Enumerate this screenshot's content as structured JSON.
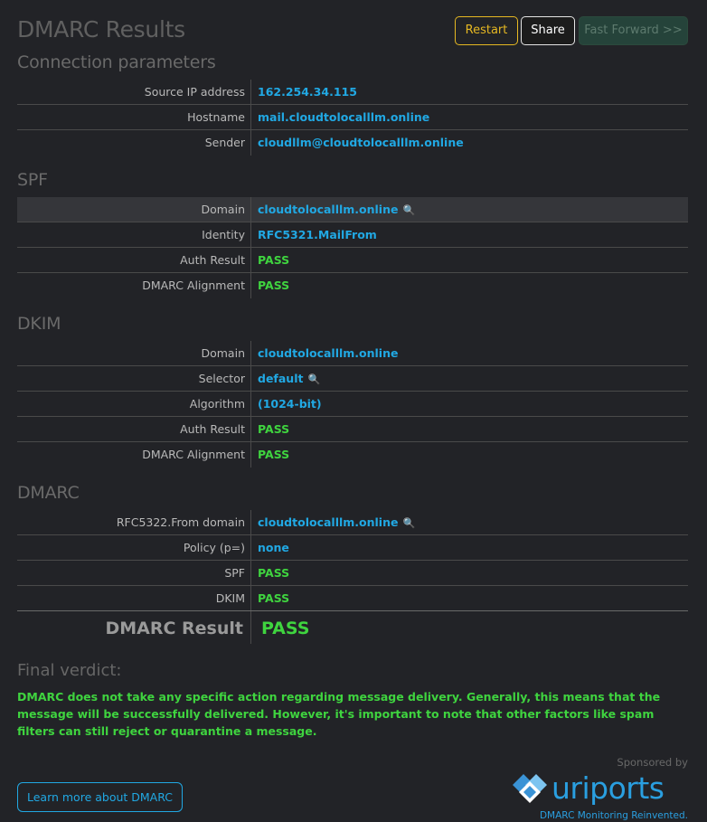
{
  "title": "DMARC Results",
  "toolbar": {
    "restart": "Restart",
    "share": "Share",
    "fast_forward": "Fast Forward >>"
  },
  "sections": {
    "connection": {
      "title": "Connection parameters",
      "rows": [
        {
          "label": "Source IP address",
          "value": "162.254.34.115"
        },
        {
          "label": "Hostname",
          "value": "mail.cloudtolocalllm.online"
        },
        {
          "label": "Sender",
          "value": "cloudllm@cloudtolocalllm.online"
        }
      ]
    },
    "spf": {
      "title": "SPF",
      "rows": [
        {
          "label": "Domain",
          "value": "cloudtolocalllm.online"
        },
        {
          "label": "Identity",
          "value": "RFC5321.MailFrom"
        },
        {
          "label": "Auth Result",
          "value": "PASS"
        },
        {
          "label": "DMARC Alignment",
          "value": "PASS"
        }
      ]
    },
    "dkim": {
      "title": "DKIM",
      "rows": [
        {
          "label": "Domain",
          "value": "cloudtolocalllm.online"
        },
        {
          "label": "Selector",
          "value": "default"
        },
        {
          "label": "Algorithm",
          "value": "(1024-bit)"
        },
        {
          "label": "Auth Result",
          "value": "PASS"
        },
        {
          "label": "DMARC Alignment",
          "value": "PASS"
        }
      ]
    },
    "dmarc": {
      "title": "DMARC",
      "rows": [
        {
          "label": "RFC5322.From domain",
          "value": "cloudtolocalllm.online"
        },
        {
          "label": "Policy (p=)",
          "value": "none"
        },
        {
          "label": "SPF",
          "value": "PASS"
        },
        {
          "label": "DKIM",
          "value": "PASS"
        }
      ],
      "result_label": "DMARC Result",
      "result_value": "PASS"
    }
  },
  "verdict": {
    "title": "Final verdict:",
    "text": "DMARC does not take any specific action regarding message delivery. Generally, this means that the message will be successfully delivered. However, it's important to note that other factors like spam filters can still reject or quarantine a message."
  },
  "learn_more": "Learn more about DMARC",
  "sponsor": {
    "sponsored_by": "Sponsored by",
    "brand": "uriports",
    "tagline": "DMARC Monitoring Reinvented."
  },
  "icons": {
    "lookup": "magnifier-icon",
    "logo": "uriports-logo-icon"
  },
  "colors": {
    "background": "#222327",
    "link_blue": "#21a8e3",
    "pass_green": "#3fd43f",
    "restart_yellow": "#e6b822"
  }
}
